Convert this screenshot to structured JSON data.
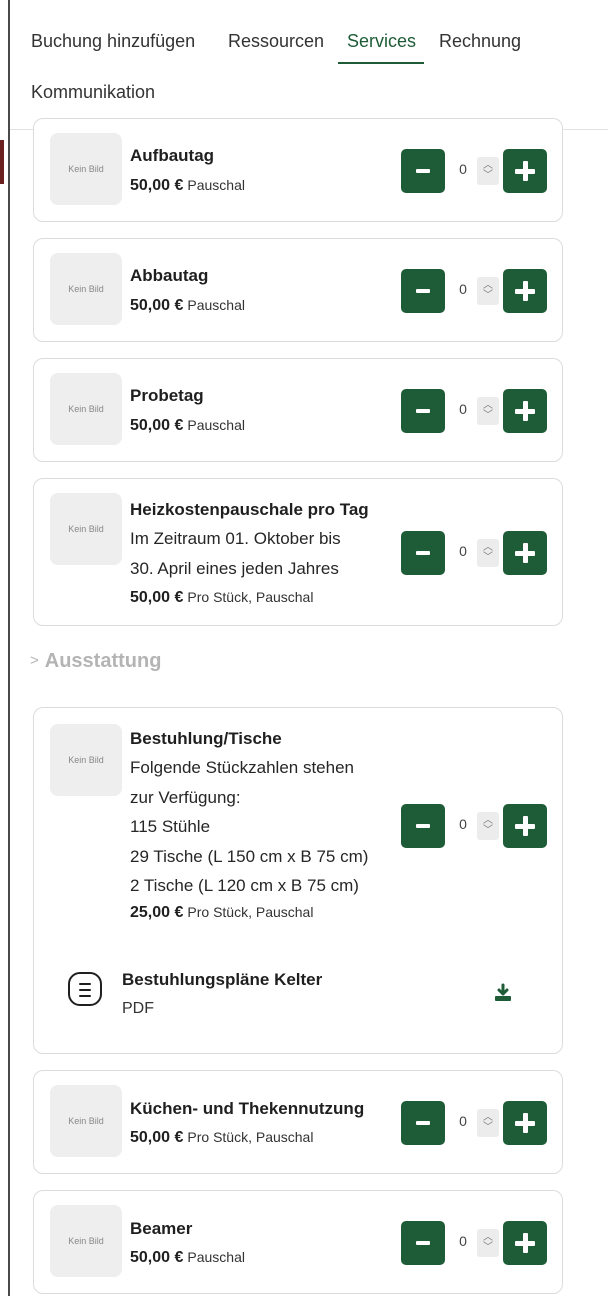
{
  "tabs": [
    {
      "label": "Buchung hinzufügen"
    },
    {
      "label": "Ressourcen"
    },
    {
      "label": "Services"
    },
    {
      "label": "Rechnung"
    },
    {
      "label": "Kommunikation"
    }
  ],
  "thumb_label": "Kein Bild",
  "qty_value": "0",
  "accent_color": "#1d5c36",
  "services": [
    {
      "title": "Aufbautag",
      "price": "50,00 €",
      "unit": "Pauschal"
    },
    {
      "title": "Abbautag",
      "price": "50,00 €",
      "unit": "Pauschal"
    },
    {
      "title": "Probetag",
      "price": "50,00 €",
      "unit": "Pauschal"
    },
    {
      "title": "Heizkostenpauschale pro Tag",
      "description": [
        "Im Zeitraum 01. Oktober bis",
        "30. April eines jeden Jahres"
      ],
      "price": "50,00 €",
      "unit": "Pro Stück, Pauschal"
    }
  ],
  "section": {
    "label": "Ausstattung"
  },
  "equipment": [
    {
      "title": "Bestuhlung/Tische",
      "description": [
        "Folgende Stückzahlen stehen",
        "zur Verfügung:",
        "115 Stühle",
        "29 Tische (L 150 cm x B 75 cm)",
        "2 Tische (L 120 cm x B 75 cm)"
      ],
      "price": "25,00 €",
      "unit": "Pro Stück, Pauschal",
      "attachment": {
        "name": "Bestuhlungspläne Kelter",
        "type": "PDF"
      }
    },
    {
      "title": "Küchen- und Thekennutzung",
      "price": "50,00 €",
      "unit": "Pro Stück, Pauschal"
    },
    {
      "title": "Beamer",
      "price": "50,00 €",
      "unit": "Pauschal"
    }
  ]
}
